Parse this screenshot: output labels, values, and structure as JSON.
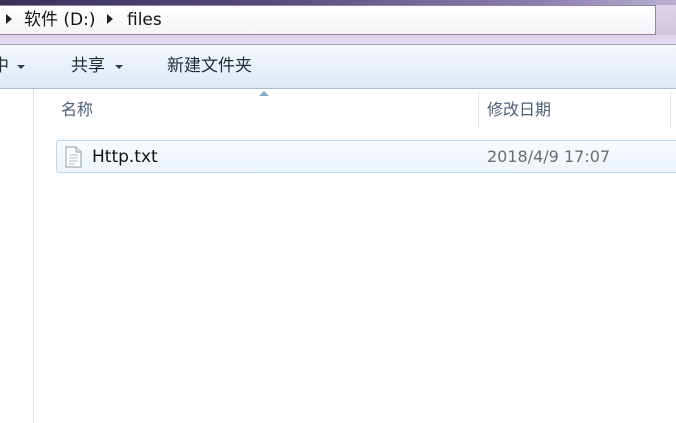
{
  "address_bar": {
    "crumbs": [
      {
        "label": "软件 (D:)"
      },
      {
        "label": "files"
      }
    ]
  },
  "toolbar": {
    "partial_item_label": "中",
    "share_label": "共享",
    "new_folder_label": "新建文件夹"
  },
  "file_list": {
    "columns": {
      "name": "名称",
      "date_modified": "修改日期"
    },
    "sort": {
      "column": "name",
      "direction": "ascending"
    },
    "rows": [
      {
        "name": "Http.txt",
        "date_modified": "2018/4/9 17:07",
        "icon": "text-file-icon"
      }
    ]
  },
  "colors": {
    "accent_border": "#b8d6ef",
    "row_highlight": "#edf5fc",
    "header_text": "#4c607a"
  }
}
